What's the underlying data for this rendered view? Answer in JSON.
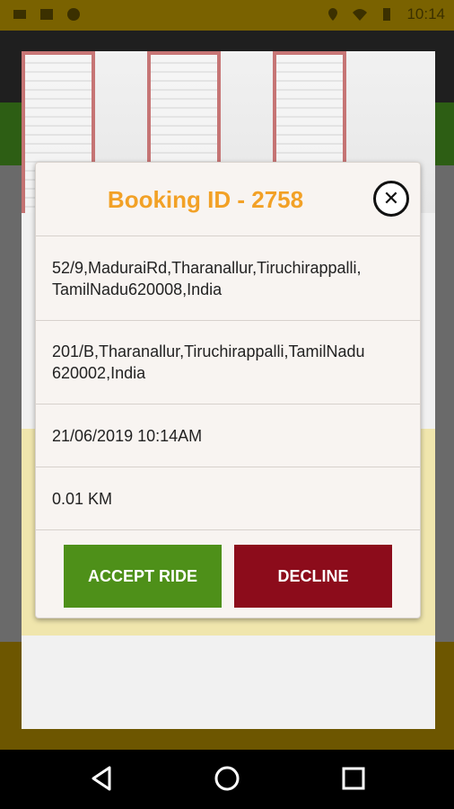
{
  "status_bar": {
    "time": "10:14",
    "left_icons": [
      "mail-icon",
      "message-icon",
      "notification-dot-icon"
    ],
    "right_icons": [
      "location-icon",
      "wifi-icon",
      "battery-icon"
    ]
  },
  "dialog": {
    "title": "Booking ID - 2758",
    "pickup_address": "52/9,MaduraiRd,Tharanallur,Tiruchirappalli, TamilNadu620008,India",
    "drop_address": "201/B,Tharanallur,Tiruchirappalli,TamilNadu 620002,India",
    "date_time": "21/06/2019 10:14AM",
    "distance": "0.01 KM",
    "accept_label": "ACCEPT RIDE",
    "decline_label": "DECLINE",
    "close_icon": "close-icon"
  },
  "colors": {
    "title": "#f2a126",
    "accept": "#4e9019",
    "decline": "#8c0c1b",
    "dialog_bg": "#f8f4f1"
  },
  "nav": {
    "icons": [
      "back-icon",
      "home-icon",
      "recents-icon"
    ]
  }
}
